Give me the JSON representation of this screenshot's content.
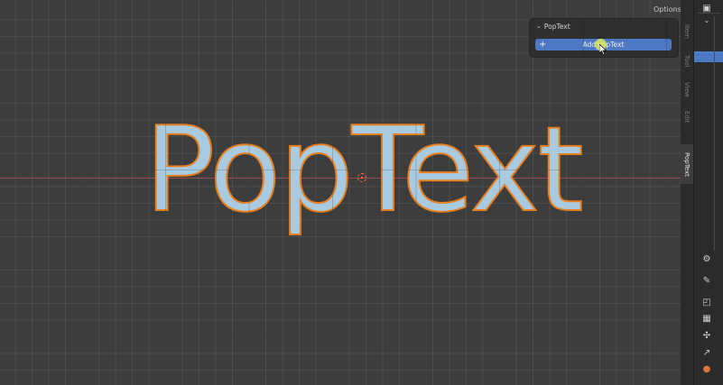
{
  "header": {
    "options_label": "Options"
  },
  "panel": {
    "title": "PopText",
    "add_button_label": "Add PopText"
  },
  "scene": {
    "text_object": "PopText"
  },
  "side_tabs": {
    "active_tab": "PopText",
    "inactive_tabs": [
      "Item",
      "Tool",
      "View",
      "Edit"
    ]
  },
  "toolbar": {
    "icons": [
      "render-icon",
      "hierarchy-icon",
      "tool-icon",
      "paint-icon",
      "new-collection-icon",
      "camera-icon",
      "particles-icon",
      "physics-icon",
      "constraint-icon"
    ]
  },
  "colors": {
    "viewport_bg": "#3d3d3d",
    "text_fill": "#a9cbe2",
    "text_outline": "#e9801f",
    "accent_button": "#4d78c4",
    "x_axis": "#9b4a56"
  }
}
